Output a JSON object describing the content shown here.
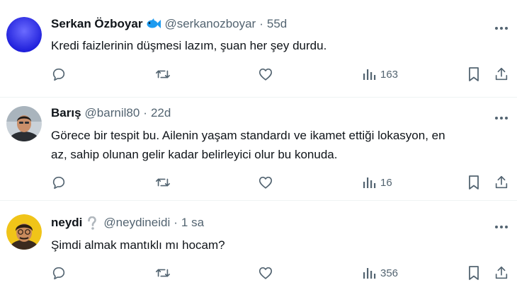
{
  "colors": {
    "text": "#0f1419",
    "secondary": "#536471",
    "separator": "#eff3f4",
    "fish_badge": "#1d9bf0",
    "question_badge": "#b0b7bd"
  },
  "tweets": [
    {
      "name": "Serkan Özboyar",
      "badge_icon": "fish-emoji-icon",
      "handle": "@serkanozboyar",
      "dot": "·",
      "time": "55d",
      "text": "Kredi faizlerinin düşmesi lazım, şuan her şey durdu.",
      "views": "163"
    },
    {
      "name": "Barış",
      "badge_icon": "",
      "handle": "@barnil80",
      "dot": "·",
      "time": "22d",
      "text_lines": [
        "Görece bir tespit bu. Ailenin yaşam standardı ve ikamet ettiği lokasyon, en",
        "az, sahip olunan gelir kadar belirleyici olur bu konuda."
      ],
      "views": "16"
    },
    {
      "name": "neydi",
      "badge_icon": "question-mark-emoji-icon",
      "handle": "@neydineidi",
      "dot": "·",
      "time": "1 sa",
      "text": "Şimdi almak mantıklı mı hocam?",
      "views": "356"
    }
  ],
  "action_icons": [
    "reply-icon",
    "retweet-icon",
    "like-icon",
    "views-icon",
    "bookmark-icon",
    "share-icon"
  ]
}
